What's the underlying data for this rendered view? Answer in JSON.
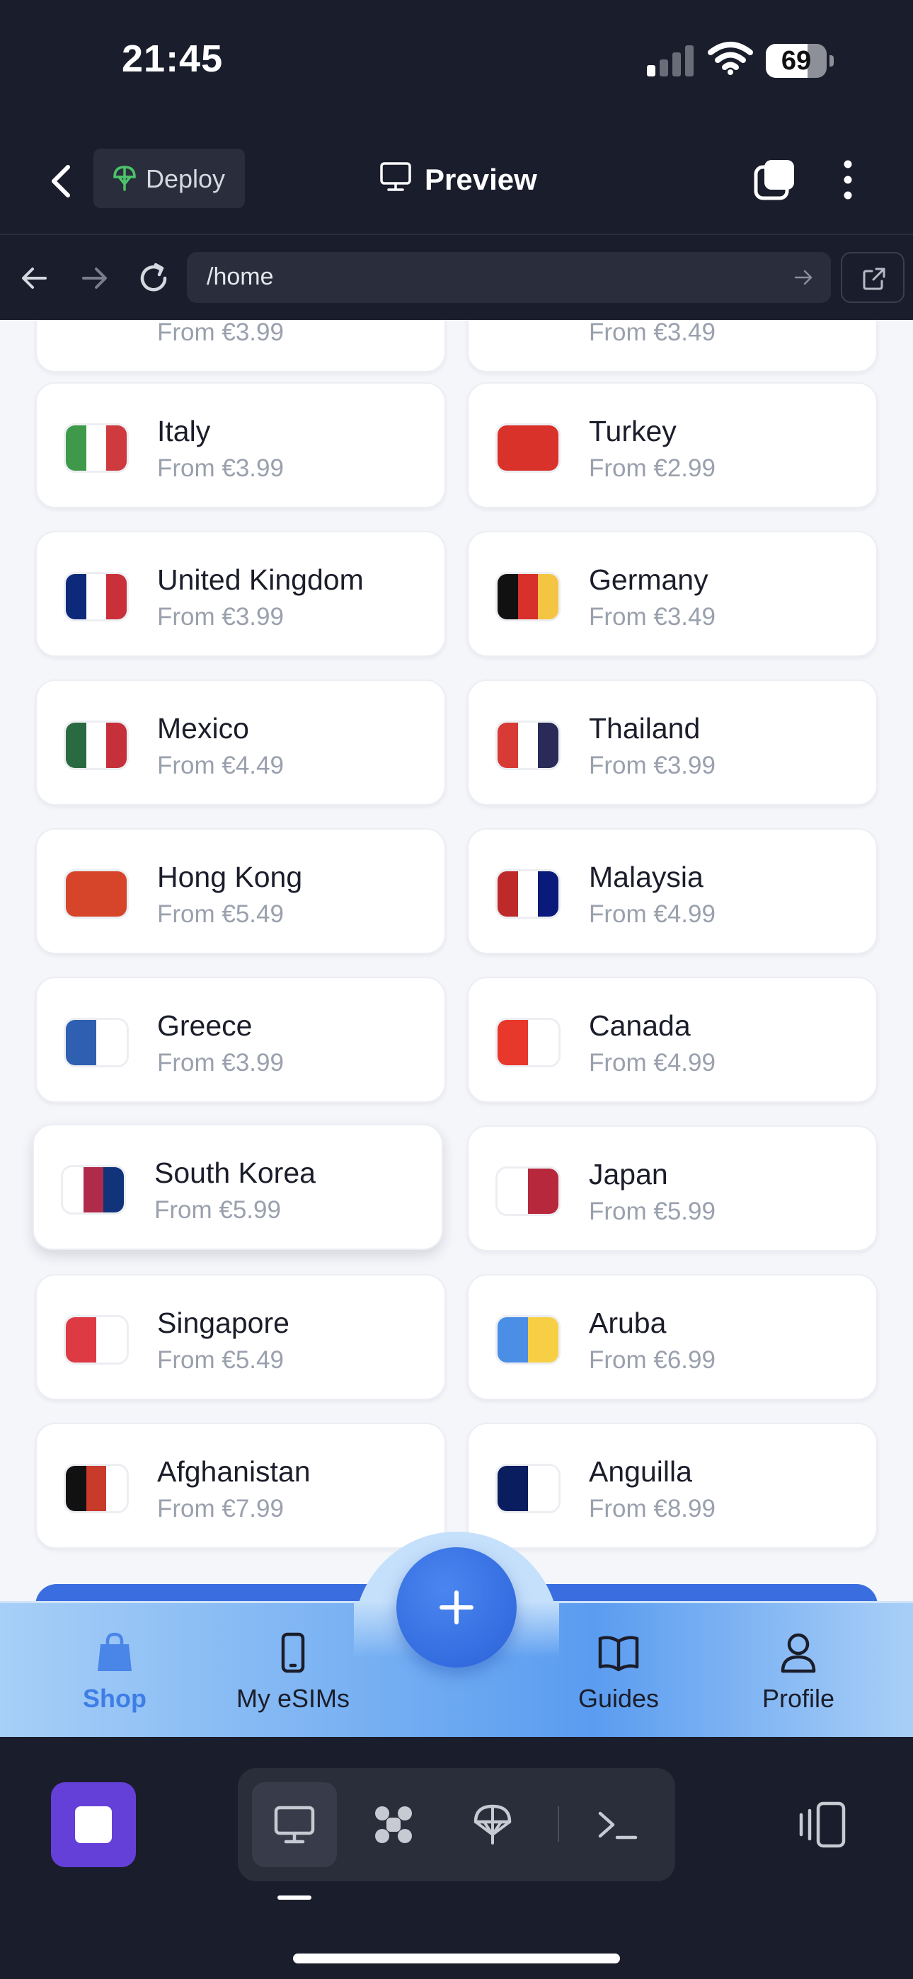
{
  "status": {
    "time": "21:45",
    "battery": "69"
  },
  "header": {
    "deploy_label": "Deploy",
    "preview_label": "Preview"
  },
  "urlbar": {
    "url": "/home"
  },
  "countries_row_partial": [
    {
      "price": "From €3.99"
    },
    {
      "price": "From €3.49"
    }
  ],
  "countries": [
    {
      "name": "Italy",
      "price": "From €3.99",
      "flag": [
        "#3e9a4a",
        "#ffffff",
        "#cf3a3e"
      ]
    },
    {
      "name": "Turkey",
      "price": "From €2.99",
      "flag": [
        "#d8322b"
      ]
    },
    {
      "name": "United Kingdom",
      "price": "From €3.99",
      "flag": [
        "#0d2a7a",
        "#ffffff",
        "#c9303a"
      ]
    },
    {
      "name": "Germany",
      "price": "From €3.49",
      "flag": [
        "#111111",
        "#d8302b",
        "#f4c542"
      ]
    },
    {
      "name": "Mexico",
      "price": "From €4.49",
      "flag": [
        "#2a6a40",
        "#ffffff",
        "#c6303a"
      ]
    },
    {
      "name": "Thailand",
      "price": "From €3.99",
      "flag": [
        "#d83a36",
        "#ffffff",
        "#2a2a58"
      ]
    },
    {
      "name": "Hong Kong",
      "price": "From €5.49",
      "flag": [
        "#d6452a"
      ]
    },
    {
      "name": "Malaysia",
      "price": "From €4.99",
      "flag": [
        "#be2a2a",
        "#ffffff",
        "#0a1a7a"
      ]
    },
    {
      "name": "Greece",
      "price": "From €3.99",
      "flag": [
        "#2e5fb0",
        "#ffffff"
      ]
    },
    {
      "name": "Canada",
      "price": "From €4.99",
      "flag": [
        "#e8372b",
        "#ffffff"
      ]
    },
    {
      "name": "South Korea",
      "price": "From €5.99",
      "flag": [
        "#ffffff",
        "#b02a4a",
        "#10337a"
      ]
    },
    {
      "name": "Japan",
      "price": "From €5.99",
      "flag": [
        "#ffffff",
        "#b8283c"
      ]
    },
    {
      "name": "Singapore",
      "price": "From €5.49",
      "flag": [
        "#de3a44",
        "#ffffff"
      ]
    },
    {
      "name": "Aruba",
      "price": "From €6.99",
      "flag": [
        "#4a8ee6",
        "#f7cf45"
      ]
    },
    {
      "name": "Afghanistan",
      "price": "From €7.99",
      "flag": [
        "#111111",
        "#c83a2a",
        "#ffffff"
      ]
    },
    {
      "name": "Anguilla",
      "price": "From €8.99",
      "flag": [
        "#0a1d5e",
        "#ffffff"
      ]
    }
  ],
  "tabbar": {
    "shop": "Shop",
    "my_esims": "My eSIMs",
    "guides": "Guides",
    "profile": "Profile"
  },
  "colors": {
    "accent": "#3f7de6",
    "fab": "#2b62d8",
    "ide_purple": "#6440d9",
    "dark_bg": "#1a1d2b"
  }
}
